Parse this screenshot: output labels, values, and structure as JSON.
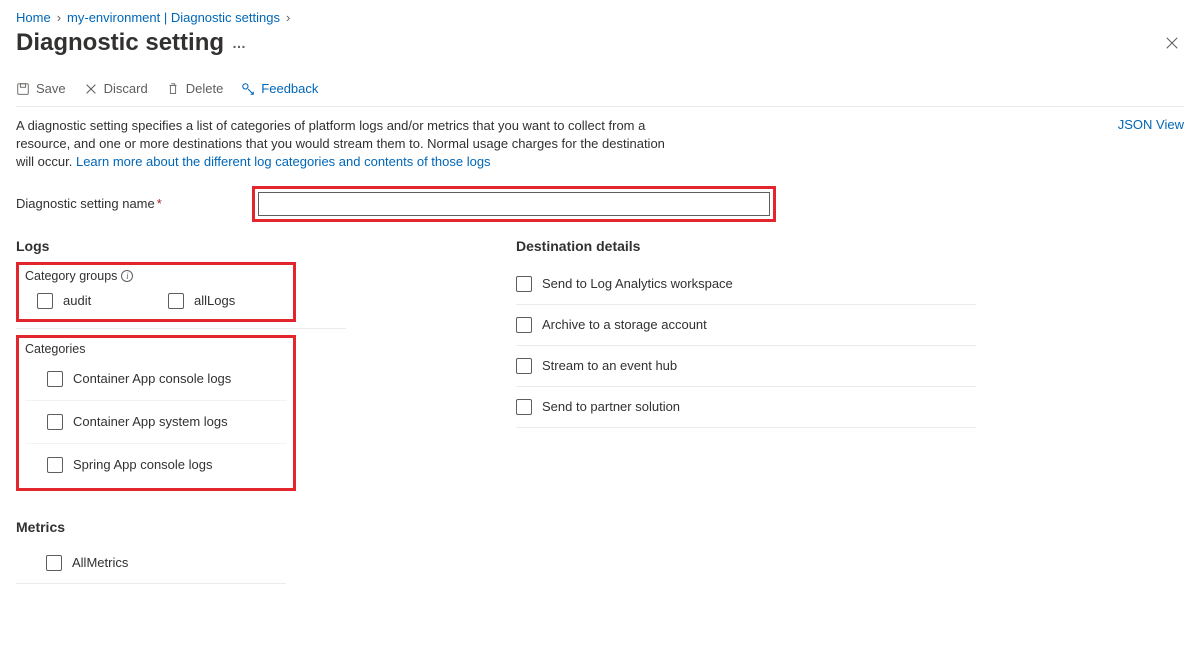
{
  "breadcrumb": {
    "home": "Home",
    "env": "my-environment | Diagnostic settings"
  },
  "header": {
    "title": "Diagnostic setting"
  },
  "toolbar": {
    "save": "Save",
    "discard": "Discard",
    "delete": "Delete",
    "feedback": "Feedback"
  },
  "json_view": "JSON View",
  "description": {
    "text": "A diagnostic setting specifies a list of categories of platform logs and/or metrics that you want to collect from a resource, and one or more destinations that you would stream them to. Normal usage charges for the destination will occur. ",
    "link": "Learn more about the different log categories and contents of those logs"
  },
  "name_field": {
    "label": "Diagnostic setting name",
    "value": ""
  },
  "logs": {
    "heading": "Logs",
    "category_groups": {
      "title": "Category groups",
      "items": [
        "audit",
        "allLogs"
      ]
    },
    "categories": {
      "title": "Categories",
      "items": [
        "Container App console logs",
        "Container App system logs",
        "Spring App console logs"
      ]
    }
  },
  "metrics": {
    "heading": "Metrics",
    "items": [
      "AllMetrics"
    ]
  },
  "destination": {
    "heading": "Destination details",
    "items": [
      "Send to Log Analytics workspace",
      "Archive to a storage account",
      "Stream to an event hub",
      "Send to partner solution"
    ]
  }
}
